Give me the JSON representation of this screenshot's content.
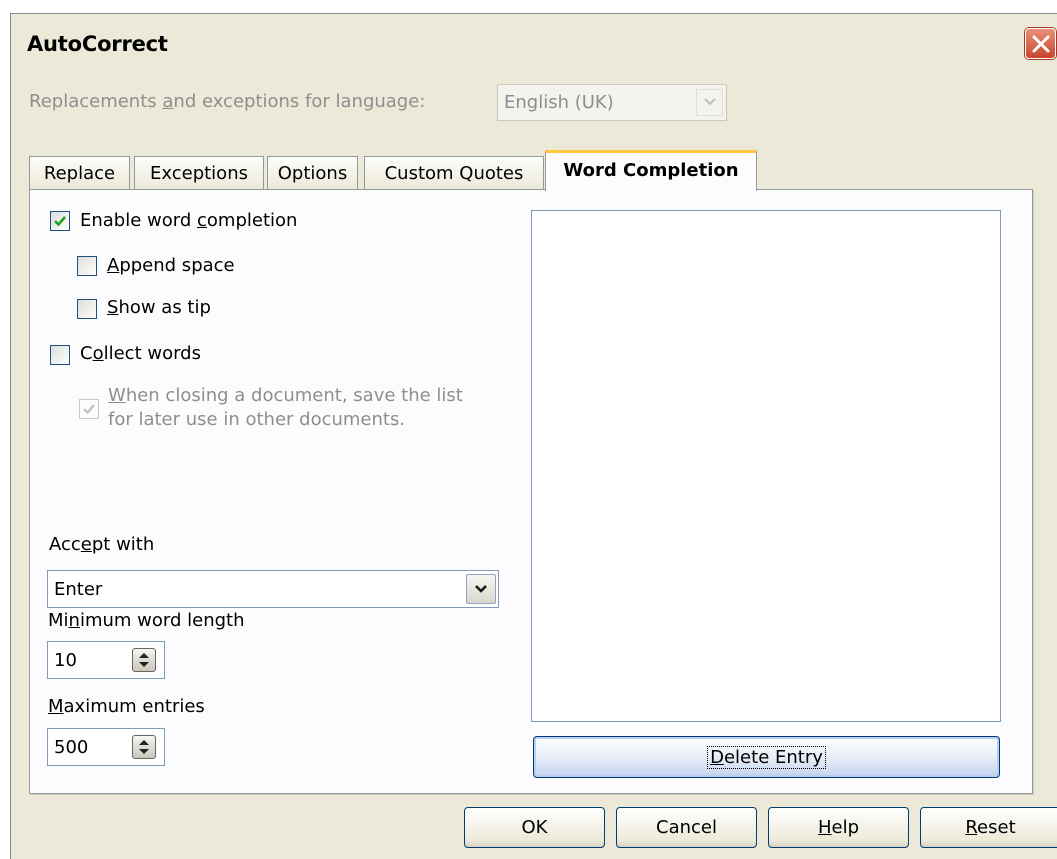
{
  "window": {
    "title": "AutoCorrect",
    "close_icon": "close-icon"
  },
  "language": {
    "label": "Replacements and exceptions for language:",
    "value": "English (UK)"
  },
  "tabs": [
    {
      "label": "Replace"
    },
    {
      "label": "Exceptions"
    },
    {
      "label": "Options"
    },
    {
      "label": "Custom Quotes"
    },
    {
      "label": "Word Completion",
      "active": true
    }
  ],
  "word_completion": {
    "enable": {
      "label": "Enable word completion",
      "checked": true
    },
    "append_space": {
      "label": "Append space",
      "checked": false
    },
    "show_as_tip": {
      "label": "Show as tip",
      "checked": false
    },
    "collect_words": {
      "label": "Collect words",
      "checked": false
    },
    "save_list": {
      "line1": "When closing a document, save the list",
      "line2": "for later use in other documents.",
      "checked": true,
      "disabled": true
    },
    "accept_with": {
      "label": "Accept with",
      "value": "Enter"
    },
    "min_word_length": {
      "label": "Minimum word length",
      "value": "10"
    },
    "max_entries": {
      "label": "Maximum entries",
      "value": "500"
    },
    "delete_entry_label": "Delete Entry"
  },
  "buttons": {
    "ok": "OK",
    "cancel": "Cancel",
    "help": "Help",
    "reset": "Reset"
  },
  "colors": {
    "dialog_bg": "#ece9d8",
    "panel_bg": "#fcfcfe",
    "active_tab_accent": "#ffc83c",
    "close_button": "#c9462c"
  }
}
